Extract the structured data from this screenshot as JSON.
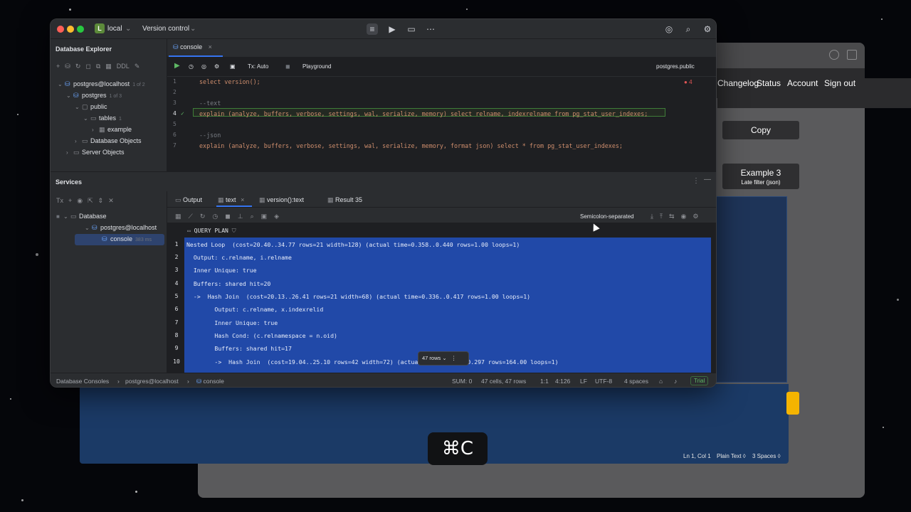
{
  "titlebar": {
    "project_badge": "L",
    "project_name": "local",
    "version_control": "Version control"
  },
  "explorer": {
    "title": "Database Explorer",
    "toolbar_ddl": "DDL",
    "tree": [
      {
        "label": "postgres@localhost",
        "hint": "1 of 2"
      },
      {
        "label": "postgres",
        "hint": "1 of 3"
      },
      {
        "label": "public",
        "hint": ""
      },
      {
        "label": "tables",
        "hint": "1"
      },
      {
        "label": "example",
        "hint": ""
      },
      {
        "label": "Database Objects",
        "hint": ""
      },
      {
        "label": "Server Objects",
        "hint": ""
      }
    ]
  },
  "editor": {
    "tab": "console",
    "tx": "Tx: Auto",
    "playground": "Playground",
    "schema": "postgres.public",
    "problems": "4",
    "lines": [
      {
        "n": "1",
        "text": "select version();"
      },
      {
        "n": "2",
        "text": ""
      },
      {
        "n": "3",
        "text": "--text"
      },
      {
        "n": "4",
        "text": "explain (analyze, buffers, verbose, settings, wal, serialize, memory) select relname, indexrelname from pg_stat_user_indexes;"
      },
      {
        "n": "5",
        "text": ""
      },
      {
        "n": "6",
        "text": "--json"
      },
      {
        "n": "7",
        "text": "explain (analyze, buffers, verbose, settings, wal, serialize, memory, format json) select * from pg_stat_user_indexes;"
      }
    ]
  },
  "services": {
    "title": "Services",
    "tree": [
      {
        "label": "Database"
      },
      {
        "label": "postgres@localhost"
      },
      {
        "label": "console",
        "hint": "383 ms"
      }
    ],
    "tabs": [
      "Output",
      "text",
      "version():text",
      "Result 35"
    ],
    "format": "Semicolon-separated",
    "column": "QUERY PLAN",
    "rows": [
      {
        "n": "1",
        "text": "Nested Loop  (cost=20.40..34.77 rows=21 width=128) (actual time=0.358..0.440 rows=1.00 loops=1)"
      },
      {
        "n": "2",
        "text": "  Output: c.relname, i.relname"
      },
      {
        "n": "3",
        "text": "  Inner Unique: true"
      },
      {
        "n": "4",
        "text": "  Buffers: shared hit=20"
      },
      {
        "n": "5",
        "text": "  ->  Hash Join  (cost=20.13..26.41 rows=21 width=68) (actual time=0.336..0.417 rows=1.00 loops=1)"
      },
      {
        "n": "6",
        "text": "        Output: c.relname, x.indexrelid"
      },
      {
        "n": "7",
        "text": "        Inner Unique: true"
      },
      {
        "n": "8",
        "text": "        Hash Cond: (c.relnamespace = n.oid)"
      },
      {
        "n": "9",
        "text": "        Buffers: shared hit=17"
      },
      {
        "n": "10",
        "text": "        ->  Hash Join  (cost=19.04..25.10 rows=42 width=72) (actual time=0.213..0.297 rows=164.00 loops=1)"
      }
    ],
    "rows_pill": "47 rows"
  },
  "statusbar": {
    "crumb1": "Database Consoles",
    "crumb2": "postgres@localhost",
    "crumb3": "console",
    "sum": "SUM: 0",
    "cells": "47 cells, 47 rows",
    "ratio": "1:1",
    "pos": "4:126",
    "eol": "LF",
    "enc": "UTF-8",
    "indent": "4 spaces",
    "trial": "Trial"
  },
  "background_browser": {
    "nav": [
      "Changelog",
      "Status",
      "Account",
      "Sign out"
    ],
    "copy_button": "Copy",
    "example_title": "Example 3",
    "example_sub": "Late filter (json)",
    "status": [
      "Ln 1, Col 1",
      "Plain Text ◊",
      "3 Spaces ◊"
    ]
  },
  "overlay": {
    "keystroke": "⌘C"
  }
}
